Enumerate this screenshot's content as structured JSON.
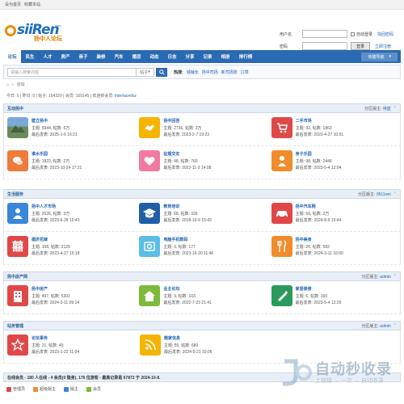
{
  "topbar": {
    "set_home": "设为首页",
    "bookmark": "收藏本站"
  },
  "logo": {
    "text": "siiRen",
    "com": "com",
    "cn": "扬中人论坛"
  },
  "login": {
    "user_label": "用户名",
    "pass_label": "密码",
    "auto_login": "自动登录",
    "find_password": "找回密码",
    "login_button": "登录",
    "register": "立即注册"
  },
  "nav": {
    "items": [
      "论坛",
      "民生",
      "人才",
      "房产",
      "亲子",
      "装修",
      "汽车",
      "婚恋",
      "动态",
      "日志",
      "分享",
      "记录",
      "相册",
      "排行榜"
    ],
    "quick": "快捷导航"
  },
  "search": {
    "placeholder": "请输入搜索内容",
    "select": "帖子",
    "hot_label": "热搜:",
    "hot_links": [
      "城铺长",
      "扬中司扬",
      "新司扬防",
      "口草"
    ]
  },
  "crumb": {
    "home": "论坛"
  },
  "stats": {
    "text": "今日: 0 | 昨日: 0 | 帖子: 164329 | 会员: 169145 | 欢迎新会员:",
    "new_member": "lnterlacedsz"
  },
  "sections": [
    {
      "title": "互动扬中",
      "moderator_label": "分区版主:",
      "moderator": "林蓝",
      "rows": [
        [
          {
            "name": "壁立扬中",
            "meta": "主题: 5944, 帖数: 6万",
            "last": "最后发表: 2025-1-9 16:21",
            "color": "#6a8a5e",
            "icon": "photo-icon"
          },
          {
            "name": "扬中回答",
            "meta": "主题: 2736, 帖数: 3万",
            "last": "最后发表: 2023-2-7 19:23",
            "color": "#f5b400",
            "icon": "handshake-icon"
          },
          {
            "name": "二手市场",
            "meta": "主题: 92, 帖数: 1863",
            "last": "最后发表: 2023-4-27 10:51",
            "color": "#e04848",
            "icon": "cart-icon"
          }
        ],
        [
          {
            "name": "谁水乐园",
            "meta": "主题: 1822, 帖数: 2万",
            "last": "最后发表: 2023-10-24 17:21",
            "color": "#f07a3c",
            "icon": "chat-icon"
          },
          {
            "name": "征婚交友",
            "meta": "主题: 48, 帖数: 760",
            "last": "最后发表: 2022-11-3 14:08",
            "color": "#f27aa0",
            "icon": "heart-icon"
          },
          {
            "name": "亲子乐园",
            "meta": "主题: 98, 帖数: 2446",
            "last": "最后发表: 2023-5-4 12:04",
            "color": "#f08c2c",
            "icon": "baby-icon"
          }
        ]
      ]
    },
    {
      "title": "生活服务",
      "moderator_label": "分区版主:",
      "moderator": "0511ren",
      "rows": [
        [
          {
            "name": "扬中人才市场",
            "meta": "主题: 2526, 帖数: 3万",
            "last": "最后发表: 2023-6-28 10:43",
            "color": "#3a86d8",
            "icon": "person-icon"
          },
          {
            "name": "教育培训",
            "meta": "主题: 68, 帖数: 326",
            "last": "最后发表: 2018-10-9 15:43",
            "color": "#1f5fa8",
            "icon": "graduation-icon"
          },
          {
            "name": "扬中汽车网",
            "meta": "主题: 56, 帖数: 2万",
            "last": "最后发表: 2024-8-9 15:44",
            "color": "#e04848",
            "icon": "car-icon"
          }
        ],
        [
          {
            "name": "婚庆花嫁",
            "meta": "主题: 158, 帖数: 2129",
            "last": "最后发表: 2023-4-27 15:18",
            "color": "#e04848",
            "icon": "wedding-icon"
          },
          {
            "name": "电脑手机数码",
            "meta": "主题: 9, 帖数: 177",
            "last": "最后发表: 2023-10-20 11:46",
            "color": "#5bbde8",
            "icon": "camera-icon"
          },
          {
            "name": "扬中美食",
            "meta": "主题: 26, 帖数: 582",
            "last": "最后发表: 2024-3-11 16:00",
            "color": "#f08c2c",
            "icon": "food-icon"
          }
        ]
      ]
    },
    {
      "title": "扬中房产网",
      "moderator_label": "分区版主:",
      "moderator": "admin",
      "rows": [
        [
          {
            "name": "扬中房产",
            "meta": "主题: 497, 帖数: 5301",
            "last": "最后发表: 2024-3-11 09:14",
            "color": "#e04848",
            "icon": "building-icon"
          },
          {
            "name": "业主论坛",
            "meta": "主题: 9, 帖数: 103",
            "last": "最后发表: 2022-7-23 21:41",
            "color": "#7dba3c",
            "icon": "house-icon"
          },
          {
            "name": "家居装修",
            "meta": "主题: 6, 帖数: 160",
            "last": "最后发表: 2023-5-4 12:29",
            "color": "#2c9a5c",
            "icon": "brush-icon"
          }
        ]
      ]
    },
    {
      "title": "站务管理",
      "moderator_label": "分区版主:",
      "moderator": "admin",
      "rows": [
        [
          {
            "name": "论坛事务",
            "meta": "主题: 21, 帖数: 40",
            "last": "最后发表: 2023-1-22 11:04",
            "color": "#e04848",
            "icon": "star-icon"
          },
          {
            "name": "微家信息",
            "meta": "主题: 55, 帖数: 680",
            "last": "最后发表: 2024-5-21 10:06",
            "color": "#f5b400",
            "icon": "rss-icon"
          }
        ]
      ]
    }
  ],
  "online": {
    "text": "在线会员 - 180 人在线 - 4 会员(0 隐身), 176 位游客 - 最高记录是 67872 于 2024-10-8."
  },
  "legend": [
    {
      "label": "管理员",
      "color": "#e04848"
    },
    {
      "label": "超级版主",
      "color": "#f08c2c"
    },
    {
      "label": "版主",
      "color": "#3a86d8"
    },
    {
      "label": "会员",
      "color": "#7dba3c"
    }
  ],
  "watermark": {
    "line1": "自动秒收录",
    "line2": "上链接 → 一次 → 自动收录"
  }
}
